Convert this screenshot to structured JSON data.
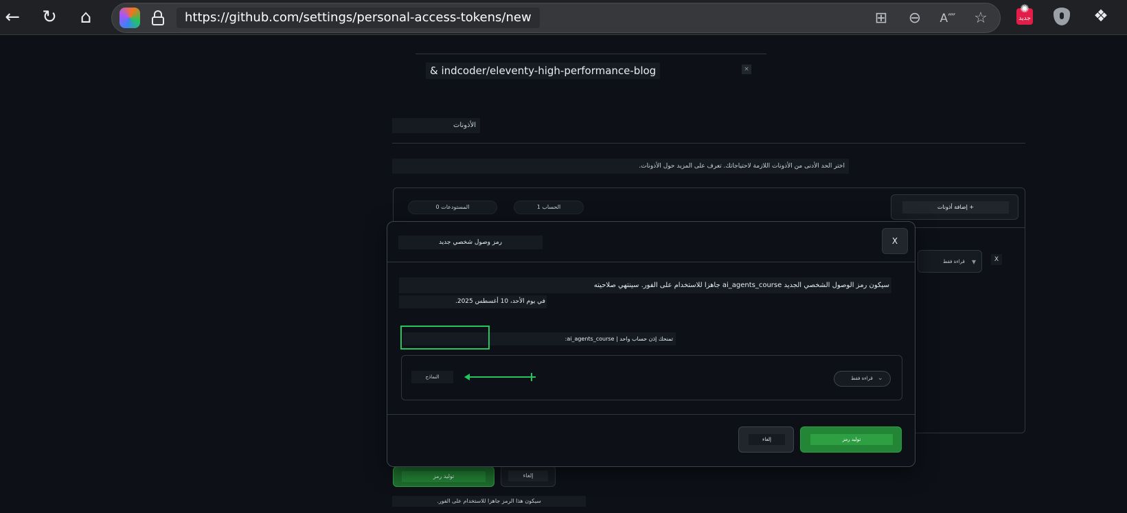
{
  "browser": {
    "url": "https://github.com/settings/personal-access-tokens/new",
    "badge_text": "جديد"
  },
  "page": {
    "repo_name": "& indcoder/eleventy-high-performance-blog",
    "repo_remove": "×",
    "permissions_heading": "الأذونات",
    "permissions_help": "اختر الحد الأدنى من الأذونات اللازمة لاحتياجاتك. تعرف على المزيد حول الأذونات.",
    "repos_pill": "المستودعات 0",
    "account_pill": "الحساب 1",
    "add_permissions": "+ إضافة أذونات",
    "access_select": "قراءة فقط",
    "row_remove": "X",
    "generate_button": "توليد رمز",
    "cancel_button": "إلغاء",
    "note": "سيكون هذا الرمز جاهزا للاستخدام على الفور."
  },
  "modal": {
    "title": "رمز وصول شخصي جديد",
    "close": "X",
    "message_line1": "سيكون رمز الوصول الشخصي الجديد ai_agents_course جاهزا للاستخدام على الفور. سينتهي صلاحيته",
    "message_line2": "في يوم الأحد، 10 أغسطس 2025.",
    "permission_summary": "تمنحك إذن حساب واحد | ai_agents_course:",
    "permission_item": "النماذج",
    "access_level": "قراءة فقط",
    "cancel_button": "إلغاء",
    "generate_button": "توليد رمز"
  },
  "colors": {
    "background": "#0d1117",
    "primary_button": "#238636",
    "annotation": "#22c55e"
  }
}
